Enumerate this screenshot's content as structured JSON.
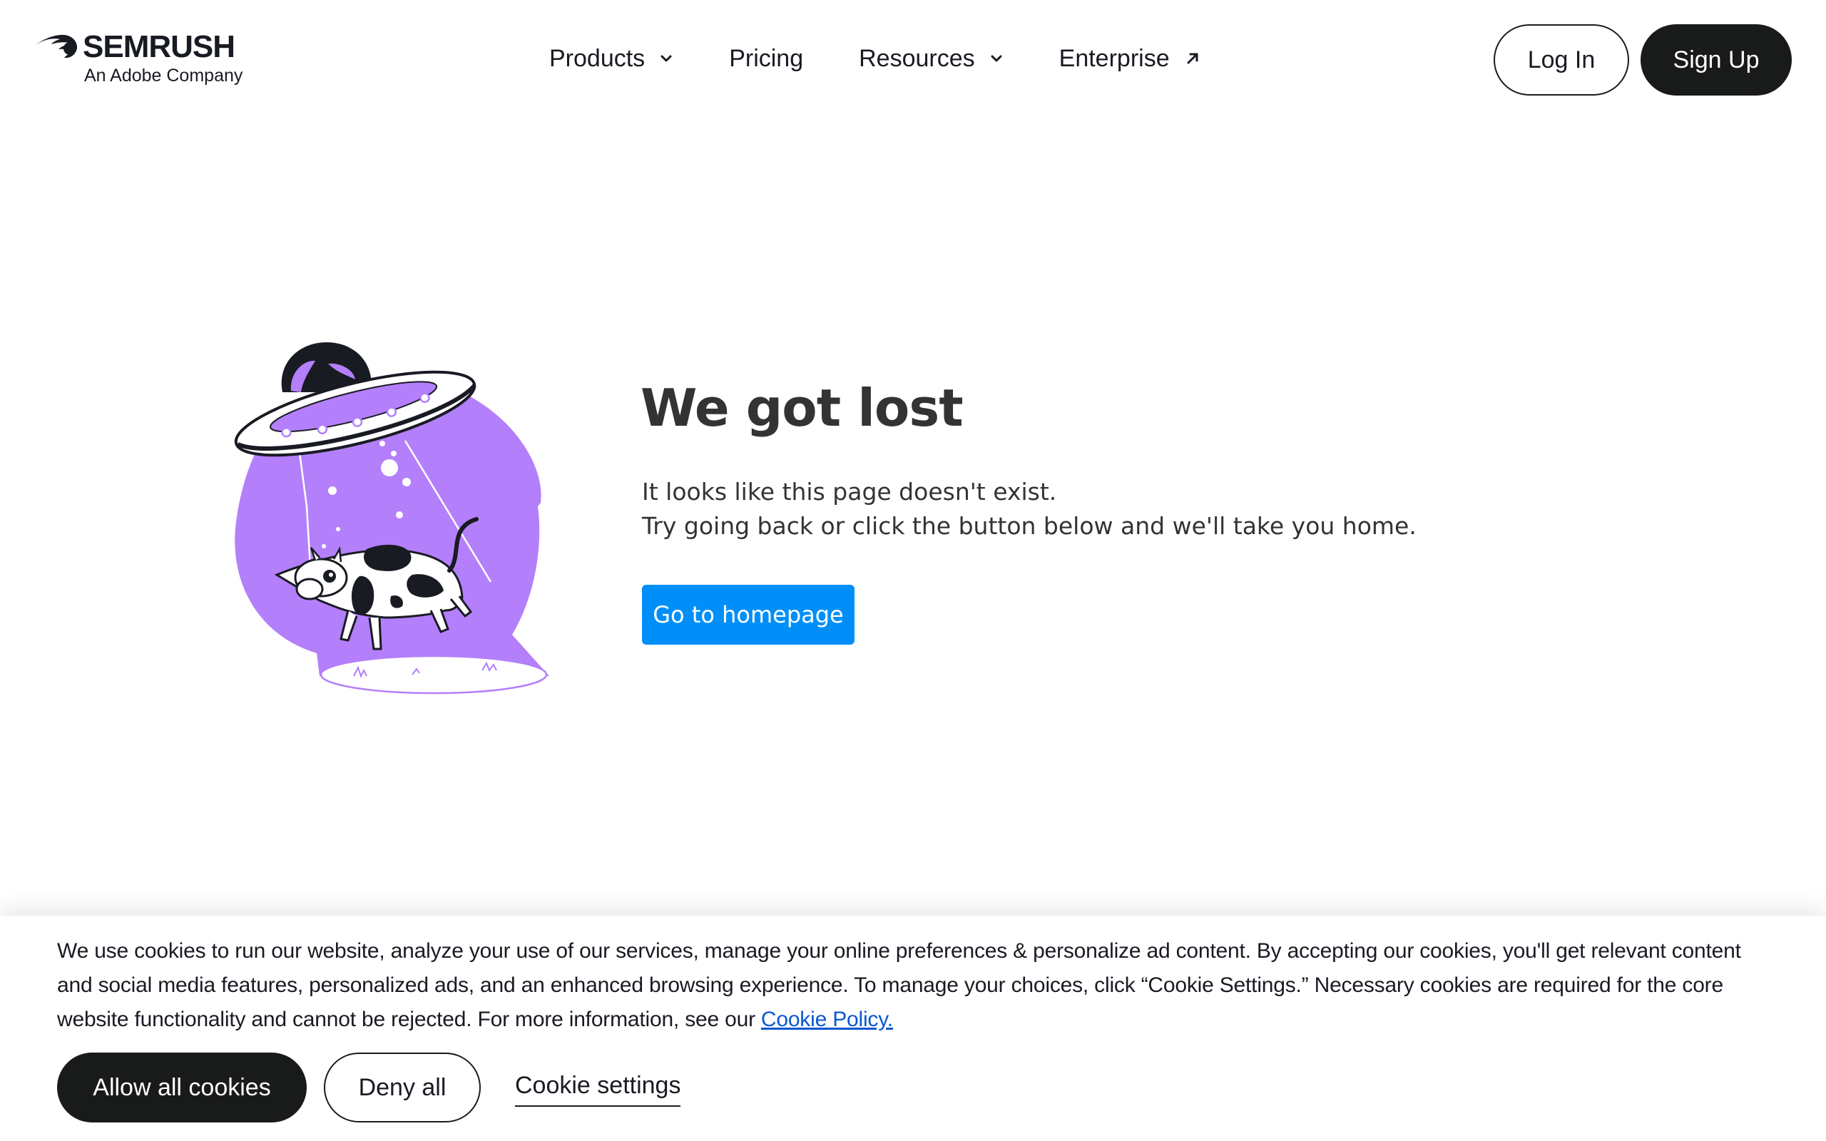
{
  "header": {
    "logo": {
      "brand": "SEMRUSH",
      "tagline": "An Adobe Company"
    },
    "nav": [
      {
        "label": "Products",
        "icon": "chevron-down-icon"
      },
      {
        "label": "Pricing"
      },
      {
        "label": "Resources",
        "icon": "chevron-down-icon"
      },
      {
        "label": "Enterprise",
        "icon": "external-arrow-icon"
      }
    ],
    "login_label": "Log In",
    "signup_label": "Sign Up"
  },
  "main": {
    "title": "We got lost",
    "line1": "It looks like this page doesn't exist.",
    "line2": "Try going back or click the button below and we'll take you home.",
    "button_label": "Go to homepage",
    "illustration": "ufo-abducting-cow-illustration"
  },
  "cookie_banner": {
    "text": "We use cookies to run our website, analyze your use of our services, manage your online preferences & personalize ad content. By accepting our cookies, you'll get relevant content and social media features, personalized ads, and an enhanced browsing experience. To manage your choices, click “Cookie Settings.” Necessary cookies are required for the core website functionality and cannot be rejected. For more information, see our",
    "policy_link": "Cookie Policy.",
    "allow_label": "Allow all cookies",
    "deny_label": "Deny all",
    "settings_label": "Cookie settings"
  },
  "colors": {
    "primary_blue": "#008ff8",
    "dark": "#191b1a",
    "illustration_purple": "#b47ffa",
    "link_blue": "#0957d0"
  }
}
